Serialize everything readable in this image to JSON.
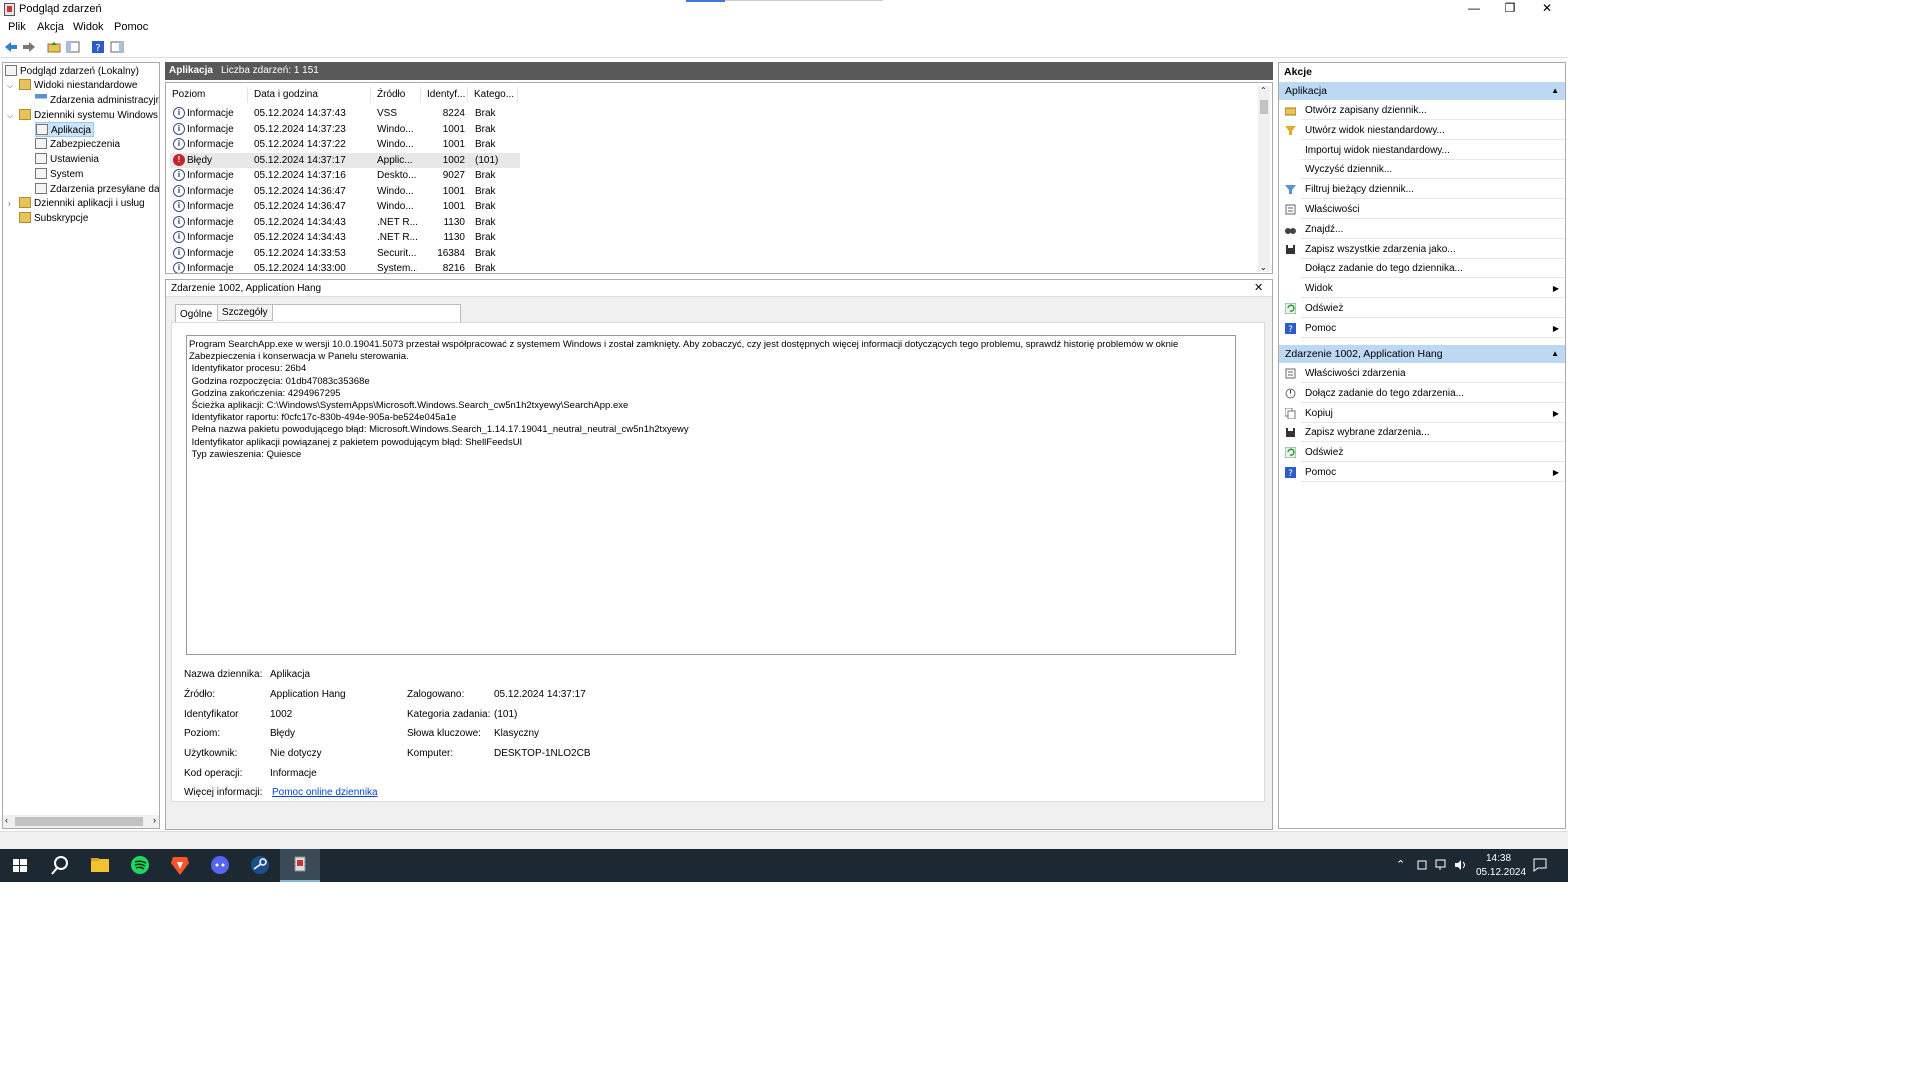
{
  "window": {
    "title": "Podgląd zdarzeń",
    "minimize": "—",
    "restore": "❐",
    "close": "✕"
  },
  "menu": [
    "Plik",
    "Akcja",
    "Widok",
    "Pomoc"
  ],
  "tree": {
    "root": "Podgląd zdarzeń (Lokalny)",
    "custom_views": "Widoki niestandardowe",
    "admin_events": "Zdarzenia administracyjne",
    "windows_logs": "Dzienniki systemu Windows",
    "application": "Aplikacja",
    "security": "Zabezpieczenia",
    "setup": "Ustawienia",
    "system": "System",
    "forwarded": "Zdarzenia przesyłane dalej",
    "app_service_logs": "Dzienniki aplikacji i usług",
    "subscriptions": "Subskrypcje"
  },
  "list_header": {
    "title": "Aplikacja",
    "count": "Liczba zdarzeń: 1 151"
  },
  "columns": [
    "Poziom",
    "Data i godzina",
    "Źródło",
    "Identyf...",
    "Katego..."
  ],
  "events": [
    {
      "level": "Informacje",
      "date": "05.12.2024 14:37:43",
      "source": "VSS",
      "id": "8224",
      "cat": "Brak",
      "type": "info"
    },
    {
      "level": "Informacje",
      "date": "05.12.2024 14:37:23",
      "source": "Windo...",
      "id": "1001",
      "cat": "Brak",
      "type": "info"
    },
    {
      "level": "Informacje",
      "date": "05.12.2024 14:37:22",
      "source": "Windo...",
      "id": "1001",
      "cat": "Brak",
      "type": "info"
    },
    {
      "level": "Błędy",
      "date": "05.12.2024 14:37:17",
      "source": "Applic...",
      "id": "1002",
      "cat": "(101)",
      "type": "error"
    },
    {
      "level": "Informacje",
      "date": "05.12.2024 14:37:16",
      "source": "Deskto...",
      "id": "9027",
      "cat": "Brak",
      "type": "info"
    },
    {
      "level": "Informacje",
      "date": "05.12.2024 14:36:47",
      "source": "Windo...",
      "id": "1001",
      "cat": "Brak",
      "type": "info"
    },
    {
      "level": "Informacje",
      "date": "05.12.2024 14:36:47",
      "source": "Windo...",
      "id": "1001",
      "cat": "Brak",
      "type": "info"
    },
    {
      "level": "Informacje",
      "date": "05.12.2024 14:34:43",
      "source": ".NET R...",
      "id": "1130",
      "cat": "Brak",
      "type": "info"
    },
    {
      "level": "Informacje",
      "date": "05.12.2024 14:34:43",
      "source": ".NET R...",
      "id": "1130",
      "cat": "Brak",
      "type": "info"
    },
    {
      "level": "Informacje",
      "date": "05.12.2024 14:33:53",
      "source": "Securit...",
      "id": "16384",
      "cat": "Brak",
      "type": "info"
    },
    {
      "level": "Informacje",
      "date": "05.12.2024 14:33:00",
      "source": "System...",
      "id": "8216",
      "cat": "Brak",
      "type": "info"
    }
  ],
  "detail": {
    "title": "Zdarzenie 1002, Application Hang",
    "close": "✕",
    "tabs": [
      "Ogólne",
      "Szczegóły"
    ],
    "description": [
      "Program SearchApp.exe w wersji 10.0.19041.5073 przestał współpracować z systemem Windows i został zamknięty. Aby zobaczyć, czy jest dostępnych więcej informacji dotyczących tego problemu, sprawdź historię problemów w oknie",
      "Zabezpieczenia i konserwacja w Panelu sterowania.",
      " Identyfikator procesu: 26b4",
      " Godzina rozpoczęcia: 01db47083c35368e",
      " Godzina zakończenia: 4294967295",
      " Ścieżka aplikacji: C:\\Windows\\SystemApps\\Microsoft.Windows.Search_cw5n1h2txyewy\\SearchApp.exe",
      " Identyfikator raportu: f0cfc17c-830b-494e-905a-be524e045a1e",
      " Pełna nazwa pakietu powodującego błąd: Microsoft.Windows.Search_1.14.17.19041_neutral_neutral_cw5n1h2txyewy",
      " Identyfikator aplikacji powiązanej z pakietem powodującym błąd: ShellFeedsUI",
      " Typ zawieszenia: Quiesce"
    ],
    "fields": {
      "log_label": "Nazwa dziennika:",
      "log_value": "Aplikacja",
      "source_label": "Źródło:",
      "source_value": "Application Hang",
      "logged_label": "Zalogowano:",
      "logged_value": "05.12.2024 14:37:17",
      "id_label": "Identyfikator",
      "id_value": "1002",
      "task_label": "Kategoria zadania:",
      "task_value": "(101)",
      "level_label": "Poziom:",
      "level_value": "Błędy",
      "keywords_label": "Słowa kluczowe:",
      "keywords_value": "Klasyczny",
      "user_label": "Użytkownik:",
      "user_value": "Nie dotyczy",
      "computer_label": "Komputer:",
      "computer_value": "DESKTOP-1NLO2CB",
      "opcode_label": "Kod operacji:",
      "opcode_value": "Informacje",
      "more_label": "Więcej informacji:",
      "more_link": "Pomoc online dziennika"
    }
  },
  "actions": {
    "title": "Akcje",
    "section1": "Aplikacja",
    "section1_items": [
      {
        "label": "Otwórz zapisany dziennik...",
        "icon": "folder-open-icon",
        "sub": false
      },
      {
        "label": "Utwórz widok niestandardowy...",
        "icon": "filter-create-icon",
        "sub": false
      },
      {
        "label": "Importuj widok niestandardowy...",
        "icon": "",
        "sub": false
      },
      {
        "label": "Wyczyść dziennik...",
        "icon": "",
        "sub": false
      },
      {
        "label": "Filtruj bieżący dziennik...",
        "icon": "filter-icon",
        "sub": false
      },
      {
        "label": "Właściwości",
        "icon": "properties-icon",
        "sub": false
      },
      {
        "label": "Znajdź...",
        "icon": "binoculars-icon",
        "sub": false
      },
      {
        "label": "Zapisz wszystkie zdarzenia jako...",
        "icon": "save-icon",
        "sub": false
      },
      {
        "label": "Dołącz zadanie do tego dziennika...",
        "icon": "",
        "sub": false
      },
      {
        "label": "Widok",
        "icon": "",
        "sub": true
      },
      {
        "label": "Odśwież",
        "icon": "refresh-icon",
        "sub": false
      },
      {
        "label": "Pomoc",
        "icon": "help-icon",
        "sub": true
      }
    ],
    "section2": "Zdarzenie 1002, Application Hang",
    "section2_items": [
      {
        "label": "Właściwości zdarzenia",
        "icon": "properties-icon",
        "sub": false
      },
      {
        "label": "Dołącz zadanie do tego zdarzenia...",
        "icon": "task-icon",
        "sub": false
      },
      {
        "label": "Kopiuj",
        "icon": "copy-icon",
        "sub": true
      },
      {
        "label": "Zapisz wybrane zdarzenia...",
        "icon": "save-icon",
        "sub": false
      },
      {
        "label": "Odśwież",
        "icon": "refresh-icon",
        "sub": false
      },
      {
        "label": "Pomoc",
        "icon": "help-icon",
        "sub": true
      }
    ]
  },
  "taskbar": {
    "time": "14:38",
    "date": "05.12.2024"
  },
  "colors": {
    "accent": "#bcd8f2",
    "header": "#595959",
    "taskbar": "#1c2933",
    "error": "#c0282e"
  }
}
